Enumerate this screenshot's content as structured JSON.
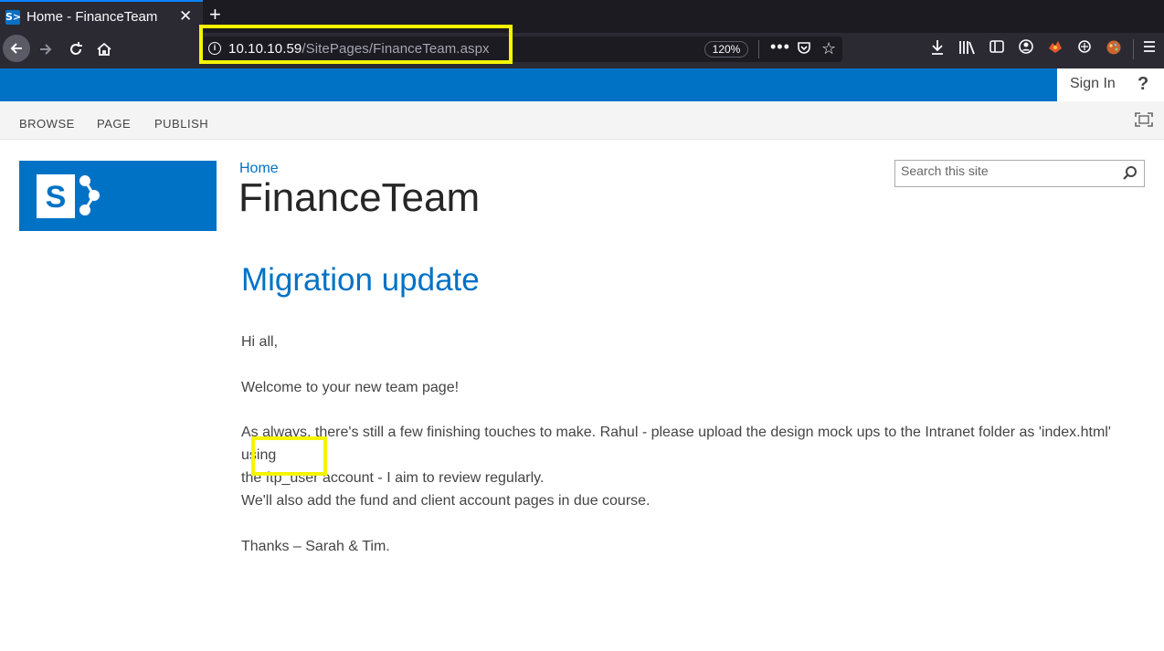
{
  "browser": {
    "tab_title": "Home - FinanceTeam",
    "tab_favicon_text": "S>",
    "url_host": "10.10.10.59",
    "url_path": "/SitePages/FinanceTeam.aspx",
    "zoom": "120%",
    "icons": [
      "back-icon",
      "forward-icon",
      "reload-icon",
      "home-icon",
      "info-icon",
      "more-icon",
      "pocket-icon",
      "bookmark-star-icon",
      "download-icon",
      "library-icon",
      "sidebar-icon",
      "account-icon",
      "extension-icon",
      "extension-icon-2",
      "extension-icon-3",
      "menu-icon"
    ]
  },
  "suitebar": {
    "sign_in": "Sign In",
    "help": "?"
  },
  "ribbon": {
    "tabs": [
      "BROWSE",
      "PAGE",
      "PUBLISH"
    ]
  },
  "site": {
    "breadcrumb": "Home",
    "title": "FinanceTeam",
    "search_placeholder": "Search this site"
  },
  "article": {
    "title": "Migration update",
    "p1": "Hi all,",
    "p2": "Welcome to your new team page!",
    "p3_line1": "As always, there's still a few finishing touches to make.  Rahul - please upload the design mock ups to the Intranet folder as 'index.html' using",
    "p3_line2_before": "the ",
    "p3_line2_highlight": "ftp_user",
    "p3_line2_after": " account - I aim to review regularly.",
    "p4": "We'll also add the fund and client account pages in due course.",
    "p5": "Thanks – Sarah & Tim."
  },
  "colors": {
    "sharepoint_blue": "#0072c6",
    "annotation_yellow": "#f5f500",
    "chrome_dark": "#2b2a33"
  }
}
